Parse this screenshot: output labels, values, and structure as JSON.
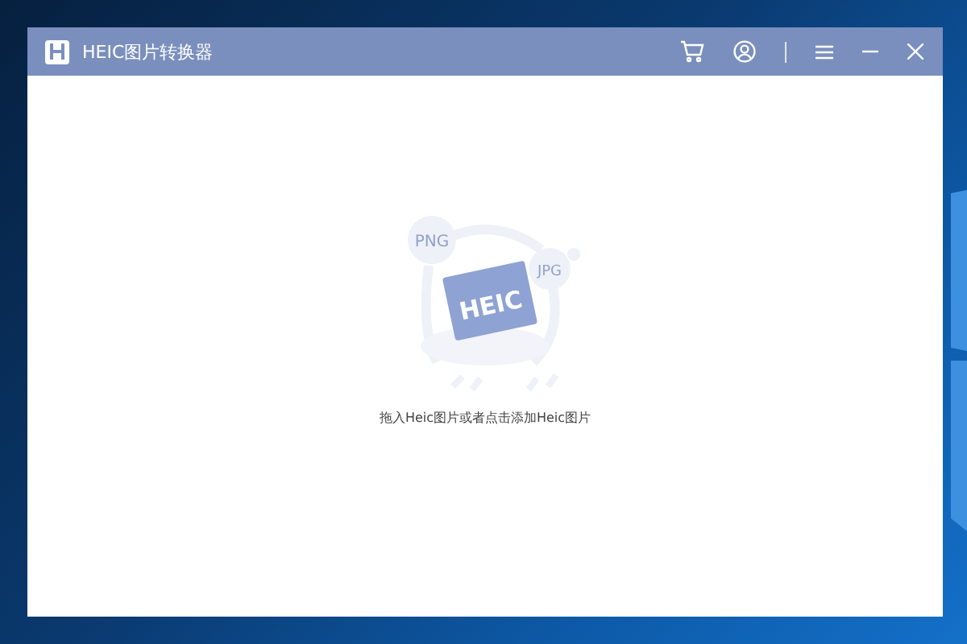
{
  "window": {
    "title": "HEIC图片转换器"
  },
  "illustration": {
    "labels": [
      "PNG",
      "JPG",
      "HEIC"
    ]
  },
  "drop_hint": "拖入Heic图片或者点击添加Heic图片"
}
